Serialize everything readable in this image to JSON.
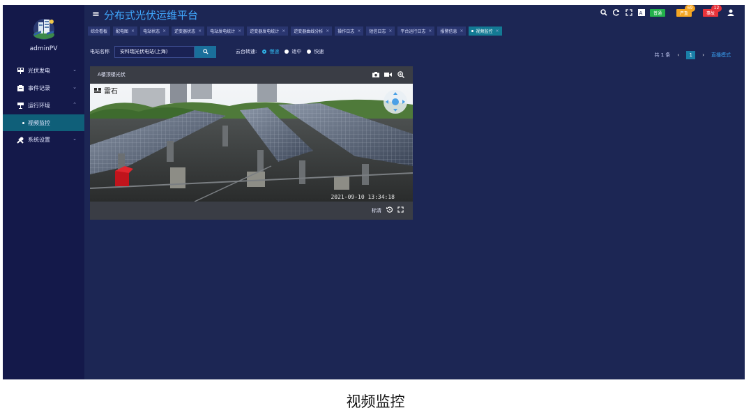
{
  "app": {
    "title": "分布式光伏运维平台",
    "username": "adminPV"
  },
  "sidebar": {
    "items": [
      {
        "label": "光伏发电",
        "icon": "solar-panel-icon",
        "arrow": "⌄"
      },
      {
        "label": "事件记录",
        "icon": "records-icon",
        "arrow": "⌄"
      },
      {
        "label": "运行环境",
        "icon": "environment-icon",
        "arrow": "⌃"
      },
      {
        "label": "视频监控",
        "icon": "dot-icon"
      },
      {
        "label": "系统设置",
        "icon": "tools-icon",
        "arrow": "⌄"
      }
    ]
  },
  "header": {
    "badges": [
      {
        "label": "普通",
        "color": "#22b04b"
      },
      {
        "label": "严重",
        "color": "#f5a623",
        "count": "69"
      },
      {
        "label": "事故",
        "color": "#e8333a",
        "count": "12"
      }
    ]
  },
  "tabs": [
    {
      "label": "综合看板"
    },
    {
      "label": "配电图"
    },
    {
      "label": "电站状态"
    },
    {
      "label": "逆变器状态"
    },
    {
      "label": "电站发电统计"
    },
    {
      "label": "逆变器发电统计"
    },
    {
      "label": "逆变器曲线分析"
    },
    {
      "label": "操作日志"
    },
    {
      "label": "短信日志"
    },
    {
      "label": "平台运行日志"
    },
    {
      "label": "报警信息"
    },
    {
      "label": "视频监控"
    }
  ],
  "filter": {
    "station_label": "电站名称",
    "station_value": "安科瑞光伏电站(上海)",
    "speed_label": "云台转速:",
    "speed_options": [
      "慢速",
      "适中",
      "快速"
    ],
    "speed_selected": "慢速"
  },
  "pager": {
    "total": "共 1 条",
    "page": "1",
    "mode": "直播模式"
  },
  "video": {
    "camera_name": "A楼顶楼光伏",
    "timestamp": "2021-09-10 13:34:18",
    "quality": "标清",
    "overlay_logo": "雷石"
  },
  "caption": "视频监控"
}
